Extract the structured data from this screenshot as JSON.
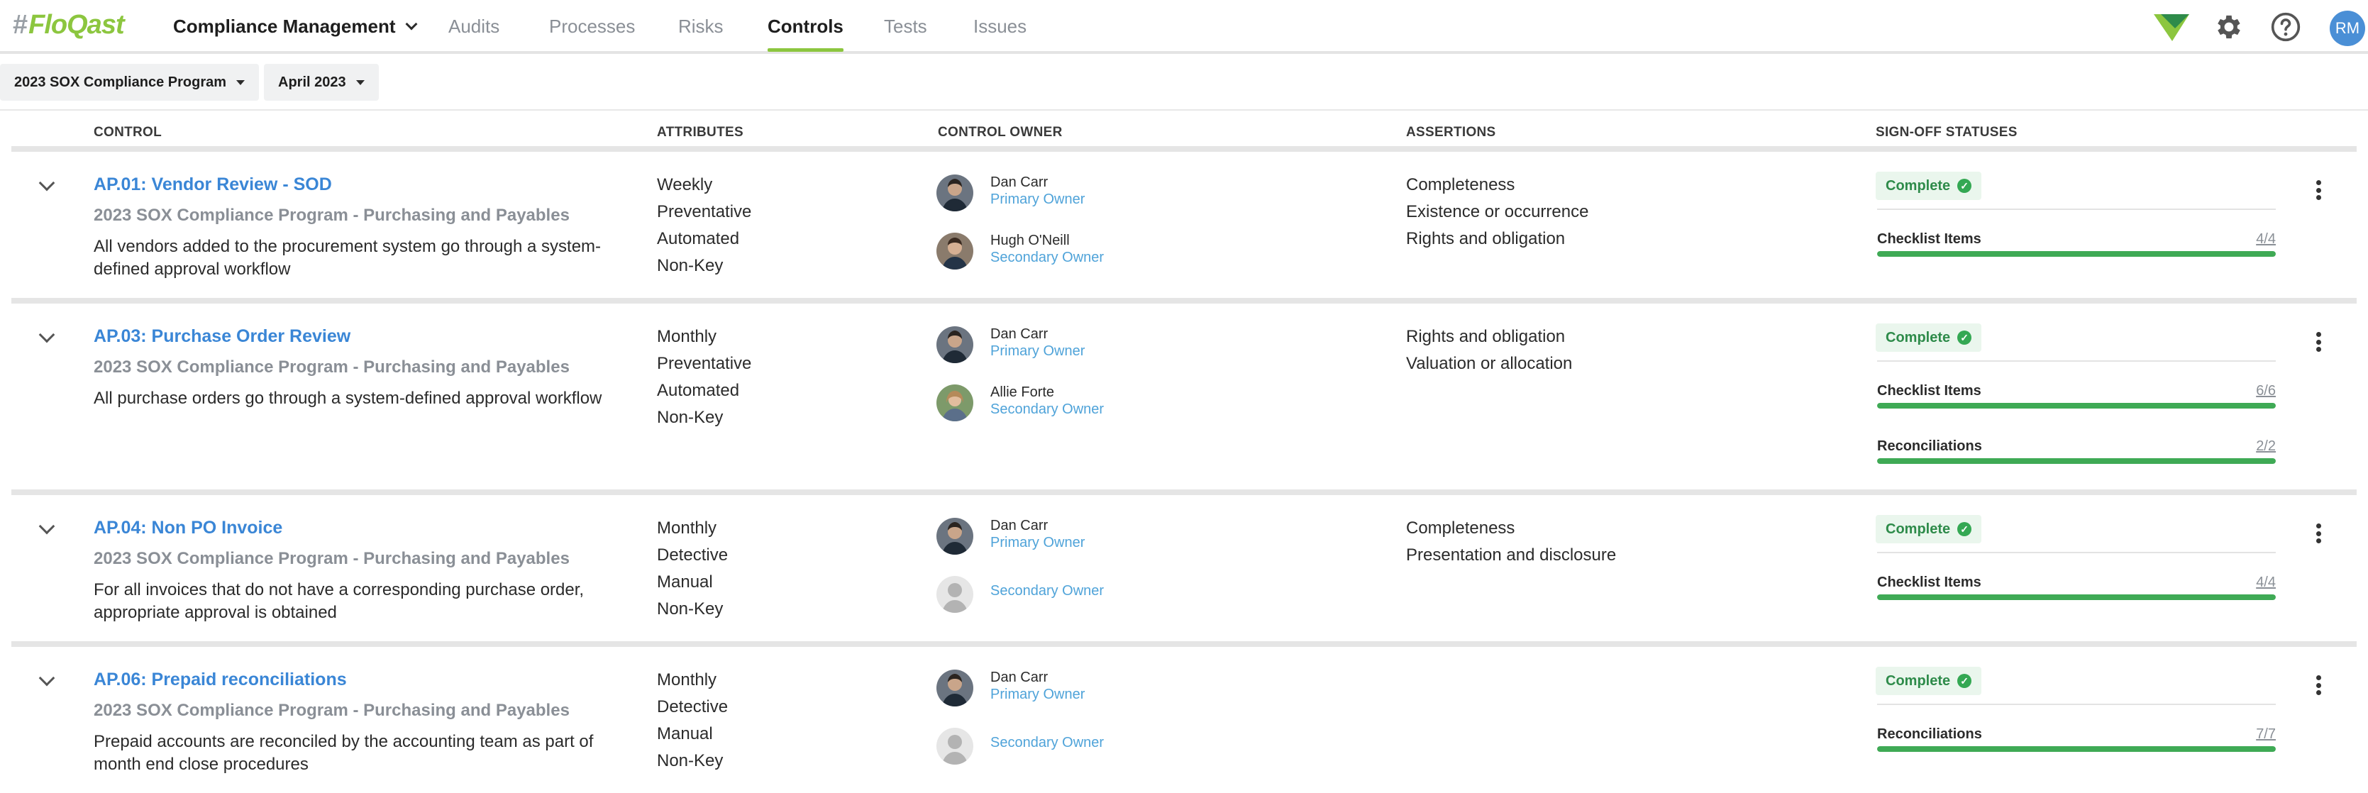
{
  "header": {
    "logo": "FloQast",
    "product": "Compliance Management",
    "tabs": [
      {
        "label": "Audits"
      },
      {
        "label": "Processes"
      },
      {
        "label": "Risks"
      },
      {
        "label": "Controls",
        "active": true
      },
      {
        "label": "Tests"
      },
      {
        "label": "Issues"
      }
    ],
    "icons": [
      "floqast-flag-icon",
      "gear-icon",
      "help-icon"
    ],
    "user_initials": "RM",
    "accent_color": "#8cc63f"
  },
  "filters": {
    "program": "2023 SOX Compliance Program",
    "period": "April 2023"
  },
  "table": {
    "columns": [
      "CONTROL",
      "ATTRIBUTES",
      "CONTROL OWNER",
      "ASSERTIONS",
      "SIGN-OFF STATUSES"
    ],
    "rows": [
      {
        "title": "AP.01: Vendor Review - SOD",
        "program": "2023 SOX Compliance Program - Purchasing and Payables",
        "description": "All vendors added to the procurement system go through a system-defined approval workflow",
        "attributes": [
          "Weekly",
          "Preventative",
          "Automated",
          "Non-Key"
        ],
        "owners": [
          {
            "name": "Dan Carr",
            "role": "Primary Owner"
          },
          {
            "name": "Hugh O'Neill",
            "role": "Secondary Owner"
          }
        ],
        "assertions": [
          "Completeness",
          "Existence or occurrence",
          "Rights and obligation"
        ],
        "status": "Complete",
        "progress": [
          {
            "label": "Checklist Items",
            "count": "4/4",
            "fraction": 1.0
          }
        ]
      },
      {
        "title": "AP.03: Purchase Order Review",
        "program": "2023 SOX Compliance Program - Purchasing and Payables",
        "description": "All purchase orders go through a system-defined approval workflow",
        "attributes": [
          "Monthly",
          "Preventative",
          "Automated",
          "Non-Key"
        ],
        "owners": [
          {
            "name": "Dan Carr",
            "role": "Primary Owner"
          },
          {
            "name": "Allie Forte",
            "role": "Secondary Owner"
          }
        ],
        "assertions": [
          "Rights and obligation",
          "Valuation or allocation"
        ],
        "status": "Complete",
        "progress": [
          {
            "label": "Checklist Items",
            "count": "6/6",
            "fraction": 1.0
          },
          {
            "label": "Reconciliations",
            "count": "2/2",
            "fraction": 1.0
          }
        ]
      },
      {
        "title": "AP.04: Non PO Invoice",
        "program": "2023 SOX Compliance Program - Purchasing and Payables",
        "description": "For all invoices that do not have a corresponding purchase order, appropriate approval is obtained",
        "attributes": [
          "Monthly",
          "Detective",
          "Manual",
          "Non-Key"
        ],
        "owners": [
          {
            "name": "Dan Carr",
            "role": "Primary Owner"
          },
          {
            "name": "",
            "role": "Secondary Owner"
          }
        ],
        "assertions": [
          "Completeness",
          "Presentation and disclosure"
        ],
        "status": "Complete",
        "progress": [
          {
            "label": "Checklist Items",
            "count": "4/4",
            "fraction": 1.0
          }
        ]
      },
      {
        "title": "AP.06: Prepaid reconciliations",
        "program": "2023 SOX Compliance Program - Purchasing and Payables",
        "description": "Prepaid accounts are reconciled by the accounting team as part of month end close procedures",
        "attributes": [
          "Monthly",
          "Detective",
          "Manual",
          "Non-Key"
        ],
        "owners": [
          {
            "name": "Dan Carr",
            "role": "Primary Owner"
          },
          {
            "name": "",
            "role": "Secondary Owner"
          }
        ],
        "assertions": [],
        "status": "Complete",
        "progress": [
          {
            "label": "Reconciliations",
            "count": "7/7",
            "fraction": 1.0
          }
        ]
      }
    ]
  }
}
